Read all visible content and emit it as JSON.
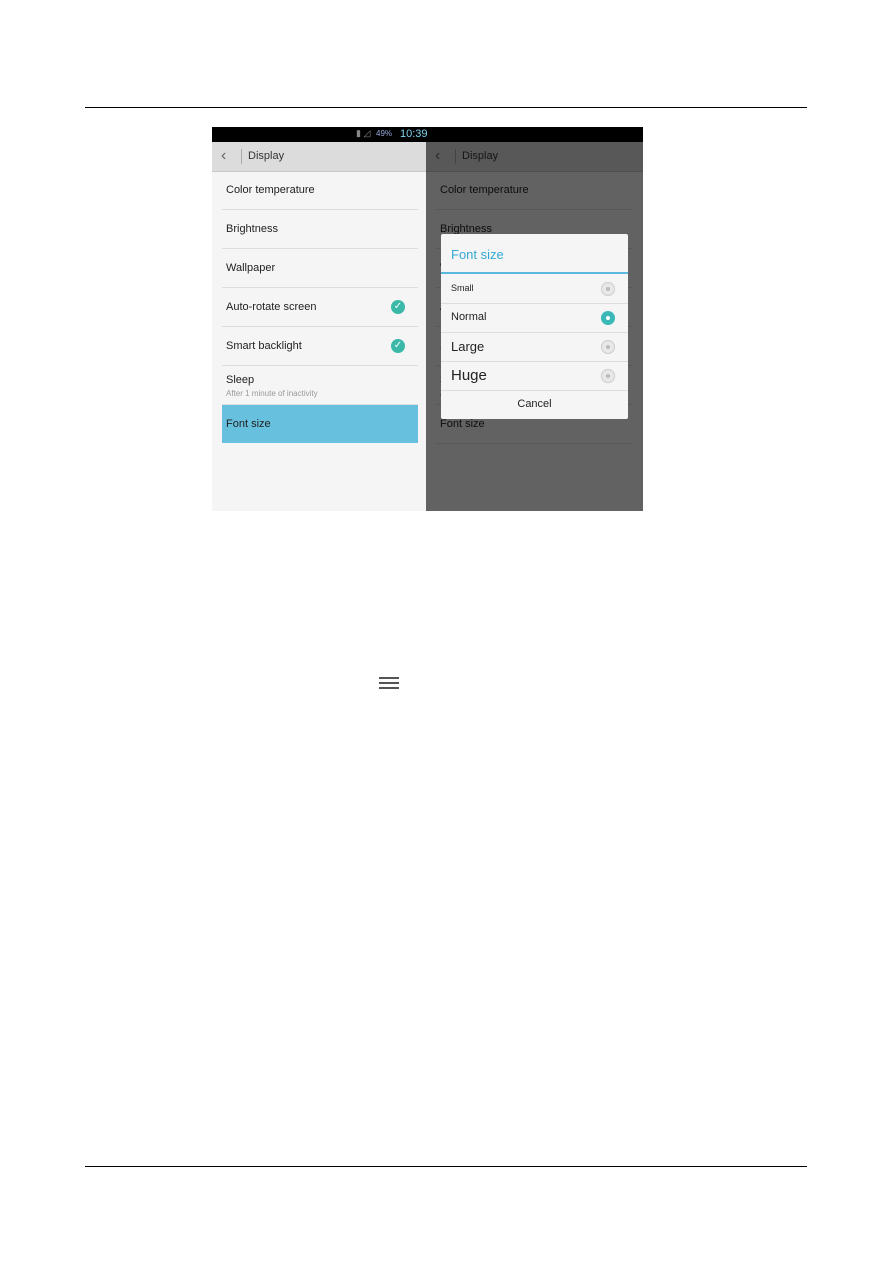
{
  "status_bar": {
    "battery": "49%",
    "time": "10:39"
  },
  "header": {
    "title": "Display"
  },
  "settings": [
    {
      "label": "Color temperature"
    },
    {
      "label": "Brightness"
    },
    {
      "label": "Wallpaper"
    },
    {
      "label": "Auto-rotate screen",
      "checked": true
    },
    {
      "label": "Smart backlight",
      "checked": true
    },
    {
      "label": "Sleep",
      "sub": "After 1 minute of inactivity"
    },
    {
      "label": "Font size",
      "highlighted": true
    }
  ],
  "dialog": {
    "title": "Font size",
    "options": [
      "Small",
      "Normal",
      "Large",
      "Huge"
    ],
    "selected": "Normal",
    "cancel": "Cancel"
  },
  "colors": {
    "accent": "#33a8d4",
    "highlight": "#67c0de",
    "check": "#3bb8a8"
  },
  "icons": {
    "doc": "menu-icon"
  }
}
